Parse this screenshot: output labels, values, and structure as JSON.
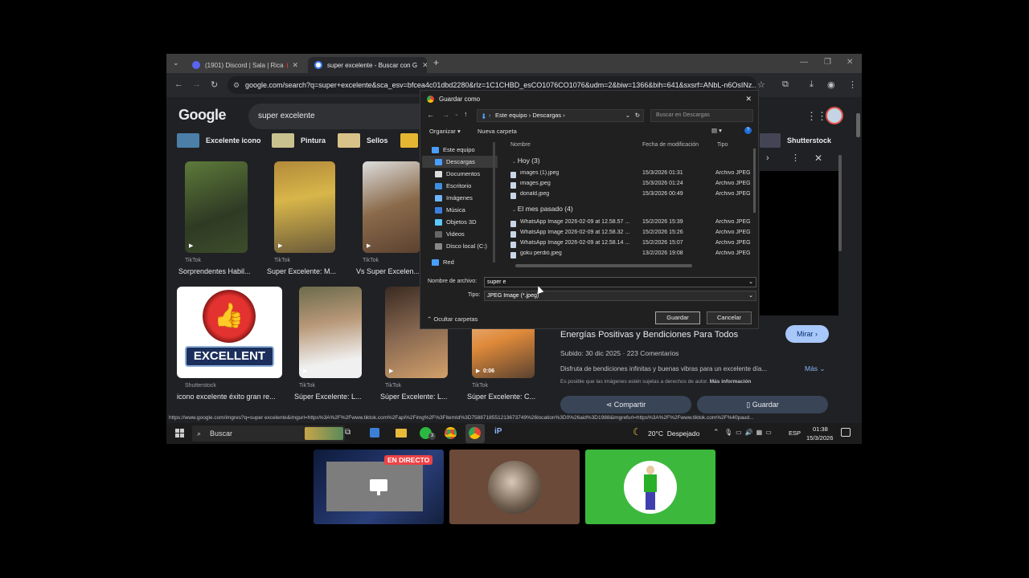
{
  "browser": {
    "tabs": [
      {
        "label": "(1901) Discord | Sala | Rica",
        "favicon_color": "#5865f2"
      },
      {
        "label": "super excelente - Buscar con G",
        "favicon_color": "#4285f4"
      }
    ],
    "new_tab": "+",
    "url": "google.com/search?q=super+excelente&sca_esv=bfcea4c01dbd2280&rlz=1C1CHBD_esCO1076CO1076&udm=2&biw=1366&bih=641&sxsrf=ANbL-n6OsINz..."
  },
  "google": {
    "logo": "Google",
    "query": "super excelente",
    "chips": [
      "Excelente icono",
      "Pintura",
      "Sellos"
    ],
    "right_chip": "Shutterstock",
    "results_row1": [
      {
        "source": "TikTok",
        "caption": "Sorprendentes Habil..."
      },
      {
        "source": "TikTok",
        "caption": "Super Excelente: M..."
      },
      {
        "source": "TikTok",
        "caption": "Vs Super Excelen..."
      }
    ],
    "results_row2": [
      {
        "source": "Shutterstock",
        "caption": "icono excelente éxito gran re...",
        "badge": "EXCELLENT"
      },
      {
        "source": "TikTok",
        "caption": "Súper Excelente: L..."
      },
      {
        "source": "TikTok",
        "caption": "Súper Excelente: L..."
      },
      {
        "source": "TikTok",
        "caption": "Súper Excelente: C...",
        "duration": "0:06"
      }
    ],
    "panel": {
      "title": "Energías Positivas y Bendiciones Para Todos",
      "visit": "Mirar",
      "meta": "Subido: 30 dic 2025 · 223 Comentarios",
      "desc": "Disfruta de bendiciones infinitas y buenas vibras para un excelente día...",
      "more": "Más",
      "notice": "Es posible que las imágenes estén sujetas a derechos de autor.",
      "notice_link": "Más información",
      "share": "Compartir",
      "save": "Guardar"
    },
    "status_url": "https://www.google.com/imgres?q=super excelente&imgurl=https%3A%2F%2Fwww.tiktok.com%2Fapi%2Fimg%2F%3FitemId%3D7588718551213673749%26location%3D0%26aid%3D1988&imgrefurl=https%3A%2F%2Fwww.tiktok.com%2F%40paud..."
  },
  "dialog": {
    "title": "Guardar como",
    "crumbs": [
      "Este equipo",
      "Descargas"
    ],
    "search_placeholder": "Buscar en Descargas",
    "organize": "Organizar",
    "new_folder": "Nueva carpeta",
    "nav": [
      "Este equipo",
      "Descargas",
      "Documentos",
      "Escritorio",
      "Imágenes",
      "Música",
      "Objetos 3D",
      "Videos",
      "Disco local (C:)",
      "Red"
    ],
    "columns": [
      "Nombre",
      "Fecha de modificación",
      "Tipo"
    ],
    "groups": [
      {
        "label": "Hoy (3)",
        "files": [
          {
            "name": "images (1).jpeg",
            "date": "15/3/2026 01:31",
            "type": "Archivo JPEG"
          },
          {
            "name": "images.jpeg",
            "date": "15/3/2026 01:24",
            "type": "Archivo JPEG"
          },
          {
            "name": "donald.jpeg",
            "date": "15/3/2026 00:49",
            "type": "Archivo JPEG"
          }
        ]
      },
      {
        "label": "El mes pasado (4)",
        "files": [
          {
            "name": "WhatsApp Image 2026-02-09 at 12.58.57 ...",
            "date": "15/2/2026 15:39",
            "type": "Archivo JPEG"
          },
          {
            "name": "WhatsApp Image 2026-02-09 at 12.58.32 ...",
            "date": "15/2/2026 15:26",
            "type": "Archivo JPEG"
          },
          {
            "name": "WhatsApp Image 2026-02-09 at 12.58.14 ...",
            "date": "15/2/2026 15:07",
            "type": "Archivo JPEG"
          },
          {
            "name": "goku perdió.jpeg",
            "date": "13/2/2026 19:08",
            "type": "Archivo JPEG"
          }
        ]
      }
    ],
    "filename_label": "Nombre de archivo:",
    "filename": "super e",
    "type_label": "Tipo:",
    "type_value": "JPEG Image (*.jpeg)",
    "hide_folders": "Ocultar carpetas",
    "save": "Guardar",
    "cancel": "Cancelar"
  },
  "taskbar": {
    "search": "Buscar",
    "weather": "20°C  Despejado",
    "lang": "ESP",
    "time": "01:38",
    "date": "15/3/2026",
    "whatsapp_badge": "3"
  },
  "stream": {
    "live": "EN DIRECTO"
  }
}
